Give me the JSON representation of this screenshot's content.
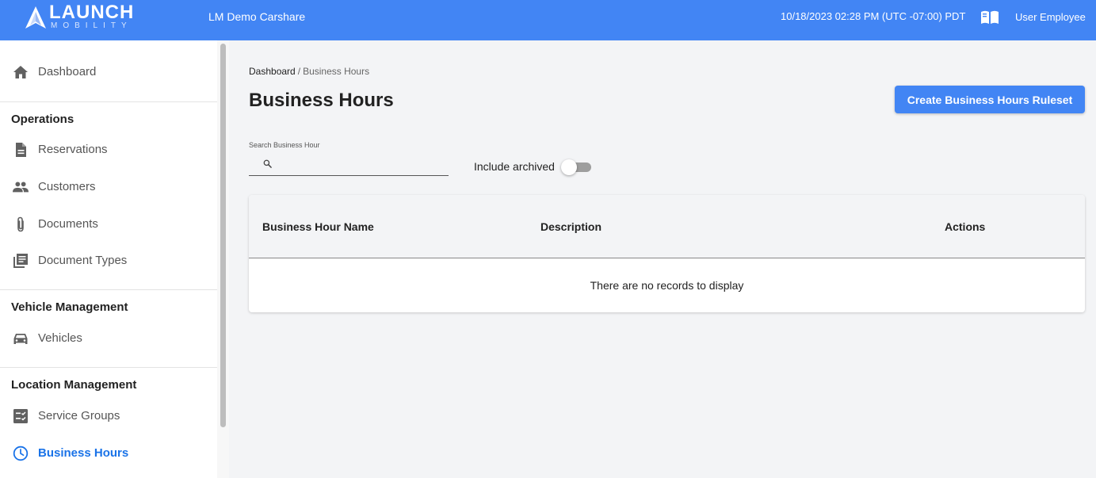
{
  "header": {
    "logo": {
      "word": "LAUNCH",
      "sub": "MOBILITY"
    },
    "org_name": "LM Demo Carshare",
    "datetime": "10/18/2023 02:28 PM (UTC -07:00) PDT",
    "help_icon": "book-open-icon",
    "user_name": "User Employee",
    "colors": {
      "bar": "#4285f4"
    }
  },
  "sidebar": {
    "dashboard": {
      "label": "Dashboard",
      "icon": "home-icon"
    },
    "sections": [
      {
        "title": "Operations",
        "items": [
          {
            "label": "Reservations",
            "icon": "document-icon"
          },
          {
            "label": "Customers",
            "icon": "people-icon"
          },
          {
            "label": "Documents",
            "icon": "paperclip-icon"
          },
          {
            "label": "Document Types",
            "icon": "library-books-icon"
          }
        ]
      },
      {
        "title": "Vehicle Management",
        "items": [
          {
            "label": "Vehicles",
            "icon": "car-icon"
          }
        ]
      },
      {
        "title": "Location Management",
        "items": [
          {
            "label": "Service Groups",
            "icon": "checklist-icon"
          },
          {
            "label": "Business Hours",
            "icon": "clock-icon",
            "active": true
          }
        ]
      }
    ],
    "active_color": "#1a73e8"
  },
  "main": {
    "breadcrumb": {
      "home": "Dashboard",
      "separator": "/",
      "current": "Business Hours"
    },
    "title": "Business Hours",
    "create_button": "Create Business Hours Ruleset",
    "search": {
      "label": "Search Business Hour",
      "value": "",
      "placeholder": ""
    },
    "include_archived": {
      "label": "Include archived",
      "checked": false
    },
    "table": {
      "columns": [
        "Business Hour Name",
        "Description",
        "Actions"
      ],
      "rows": [],
      "empty_message": "There are no records to display"
    }
  }
}
